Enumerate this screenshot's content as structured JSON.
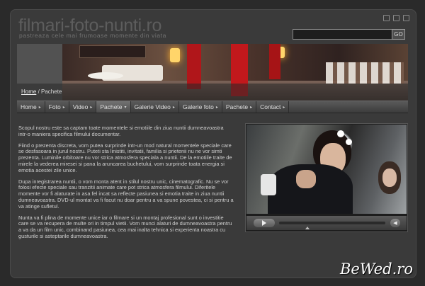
{
  "header": {
    "site_title": "filmari-foto-nunti.ro",
    "tagline": "pastreaza cele mai frumoase momente din viata",
    "icons": [
      "home-icon",
      "mail-icon",
      "sitemap-icon"
    ]
  },
  "search": {
    "value": "",
    "placeholder": "",
    "button_label": "GO"
  },
  "breadcrumb": {
    "home": "Home",
    "separator": " / ",
    "current": "Pachete"
  },
  "nav": {
    "items": [
      {
        "label": "Home",
        "arrow": "▸"
      },
      {
        "label": "Foto",
        "arrow": "▸"
      },
      {
        "label": "Video",
        "arrow": "▸"
      },
      {
        "label": "Pachete",
        "arrow": "▾"
      },
      {
        "label": "Galerie Video",
        "arrow": "▸"
      },
      {
        "label": "Galerie foto",
        "arrow": "▸"
      },
      {
        "label": "Pachete",
        "arrow": "▸"
      },
      {
        "label": "Contact",
        "arrow": "▸"
      }
    ],
    "active_index": 3
  },
  "content": {
    "paragraphs": [
      "Scopul nostru este sa captam toate momentele si emotiile din ziua nuntii dumneavoastra intr-o maniera specifica filmului documentar.",
      "Fiind o prezenta discreta, vom putea surprinde intr-un mod natural momentele speciale care se desfasoara in jurul nostru. Puteti sta linistiti, invitatii, familia si prietenii nu ne vor simti prezenta. Luminile orbitoare nu vor strica atmosfera speciala a nuntii. De la emotiile traite de mirele la vederea miresei si pana la aruncarea buchetului, vom surprinde toata energia si emotia acestei zile unice.",
      "Dupa inregistrarea nuntii, o vom monta atent in stilul nostru unic, cinematografic. Nu se vor folosi efecte speciale sau tranzitii animate care pot strica atmosfera filmului. Diferitele momente vor fi alaturate in asa fel incat sa reflecte pasiunea si emotia traite in ziua nuntii dumneavoastra. DVD-ul montat va fi facut nu doar pentru a va spune povestea, ci si pentru a va atinge sufletul.",
      "Nunta va fi plina de momente unice iar o filmare si un montaj profesional sunt o investitie care se va recupera de multe ori in timpul vietii. Vom munci alaturi de dumneavoastra pentru a va da un film unic, combinand pasiunea, cea mai inalta tehnica si experienta noastra cu gusturile si asteptarile dumneavoastra."
    ]
  },
  "video_player": {
    "progress": 0.0,
    "play_icon": "play-icon",
    "volume_icon": "volume-icon"
  },
  "watermark": "BeWed.ro"
}
